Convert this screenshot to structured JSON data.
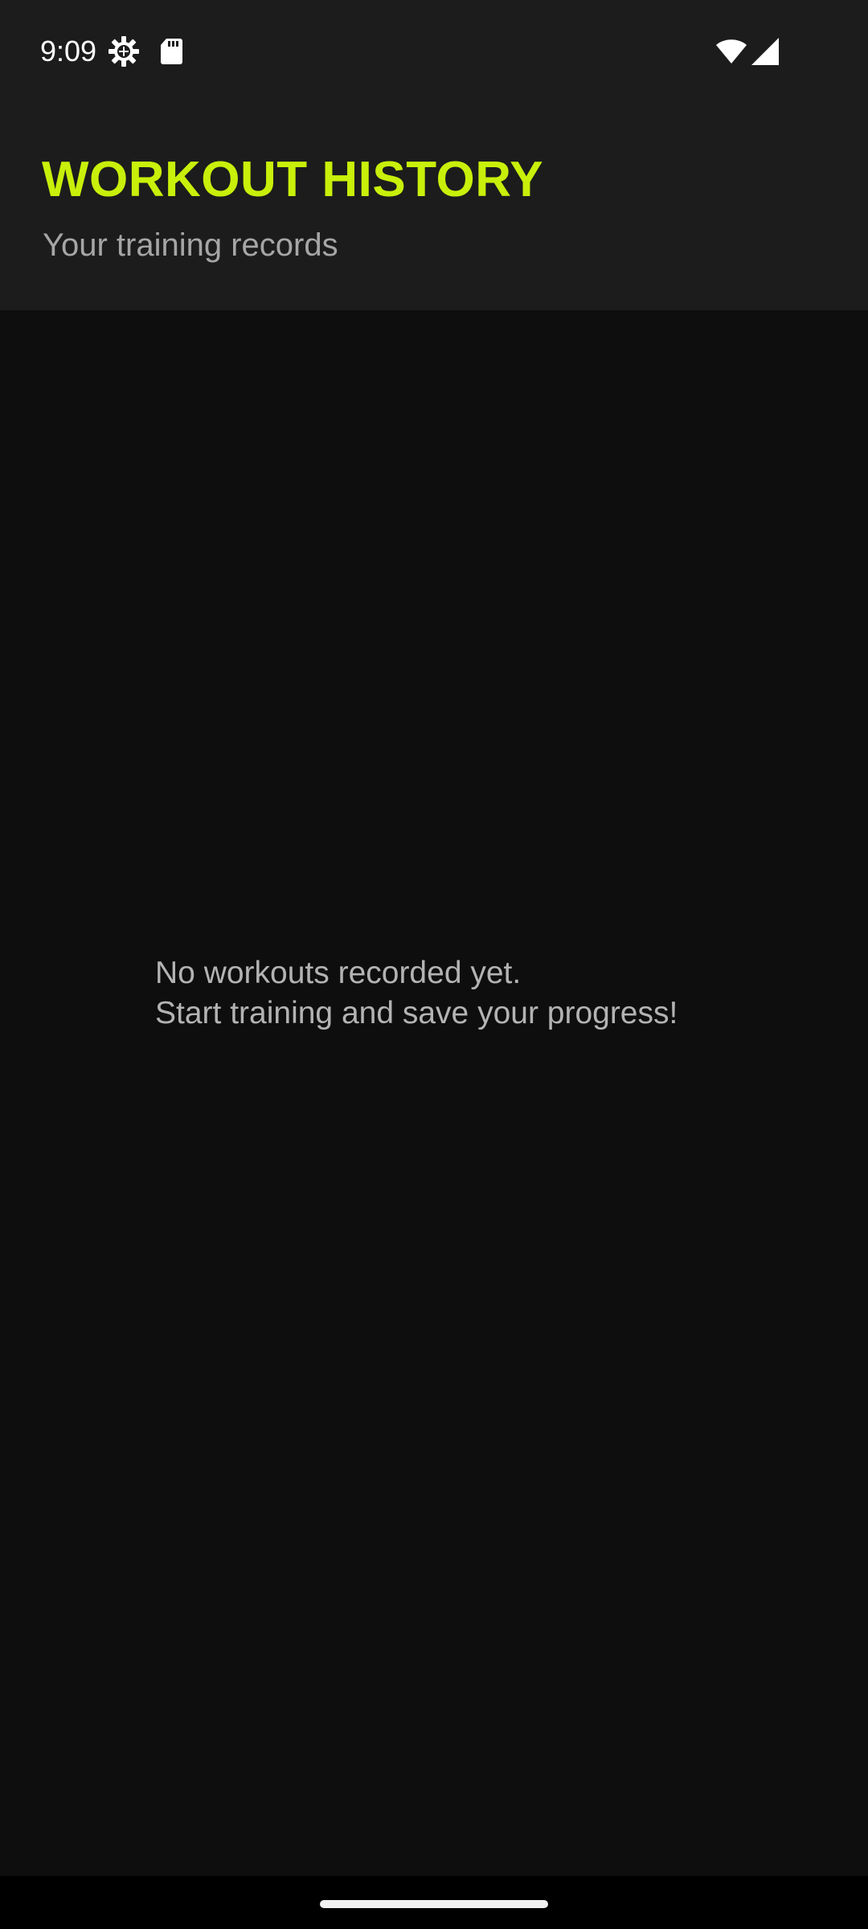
{
  "status_bar": {
    "time": "9:09",
    "icons": [
      "gear-icon",
      "sd-card-icon",
      "wifi-icon",
      "cell-signal-icon"
    ],
    "icon_color": "#ffffff"
  },
  "header": {
    "title": "WORKOUT HISTORY",
    "subtitle": "Your training records",
    "title_color": "#c8f00a",
    "background": "#1c1c1c"
  },
  "empty_state": {
    "line1": "No workouts recorded yet.",
    "line2": "Start training and save your progress!"
  },
  "colors": {
    "accent": "#c8f00a",
    "background": "#0e0e0e",
    "text_muted": "#b3b3b3"
  }
}
